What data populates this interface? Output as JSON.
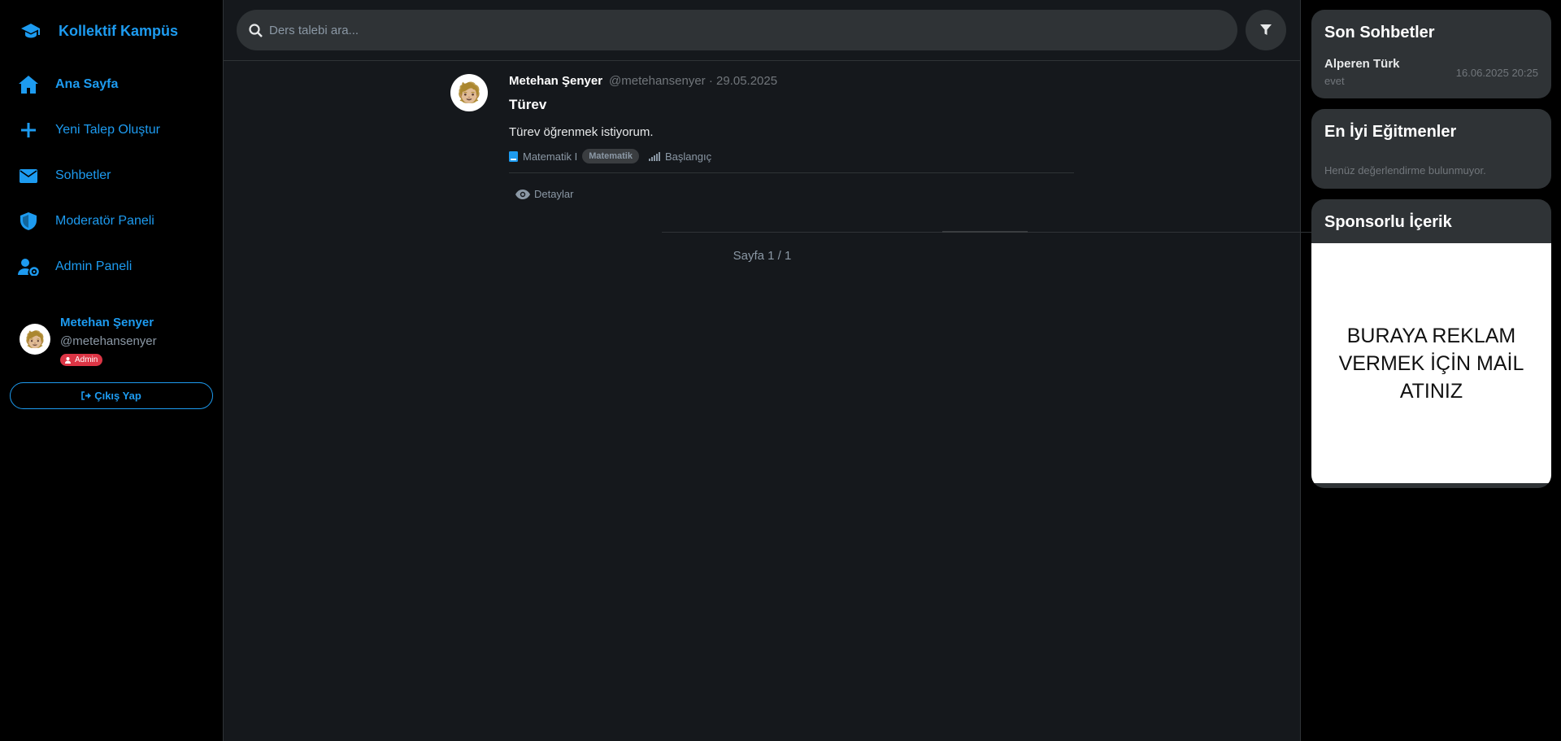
{
  "brand": {
    "name": "Kollektif Kampüs",
    "icon": "graduation-cap-icon"
  },
  "nav": [
    {
      "label": "Ana Sayfa",
      "icon": "home-icon"
    },
    {
      "label": "Yeni Talep Oluştur",
      "icon": "plus-icon"
    },
    {
      "label": "Sohbetler",
      "icon": "envelope-icon"
    },
    {
      "label": "Moderatör Paneli",
      "icon": "shield-icon"
    },
    {
      "label": "Admin Paneli",
      "icon": "user-gear-icon"
    }
  ],
  "profile": {
    "name": "Metehan Şenyer",
    "handle": "@metehansenyer",
    "badge": "Admin",
    "avatar": "🧑🏼"
  },
  "logout_label": "Çıkış Yap",
  "search": {
    "placeholder": "Ders talebi ara..."
  },
  "post": {
    "author": "Metehan Şenyer",
    "meta": "@metehansenyer · 29.05.2025",
    "title": "Türev",
    "text": "Türev öğrenmek istiyorum.",
    "course": "Matematik I",
    "category": "Matematik",
    "level": "Başlangıç",
    "details_label": "Detaylar"
  },
  "pagination": "Sayfa 1 / 1",
  "recent_chats": {
    "title": "Son Sohbetler",
    "items": [
      {
        "name": "Alperen Türk",
        "last": "evet",
        "time": "16.06.2025 20:25"
      }
    ]
  },
  "top_tutors": {
    "title": "En İyi Eğitmenler",
    "empty": "Henüz değerlendirme bulunmuyor."
  },
  "sponsored": {
    "title": "Sponsorlu İçerik",
    "ad_text": "BURAYA REKLAM VERMEK İÇİN MAİL ATINIZ"
  },
  "colors": {
    "accent": "#1d9bf0",
    "danger": "#dc3545",
    "panel": "#2f3336",
    "main_bg": "#15181c"
  }
}
